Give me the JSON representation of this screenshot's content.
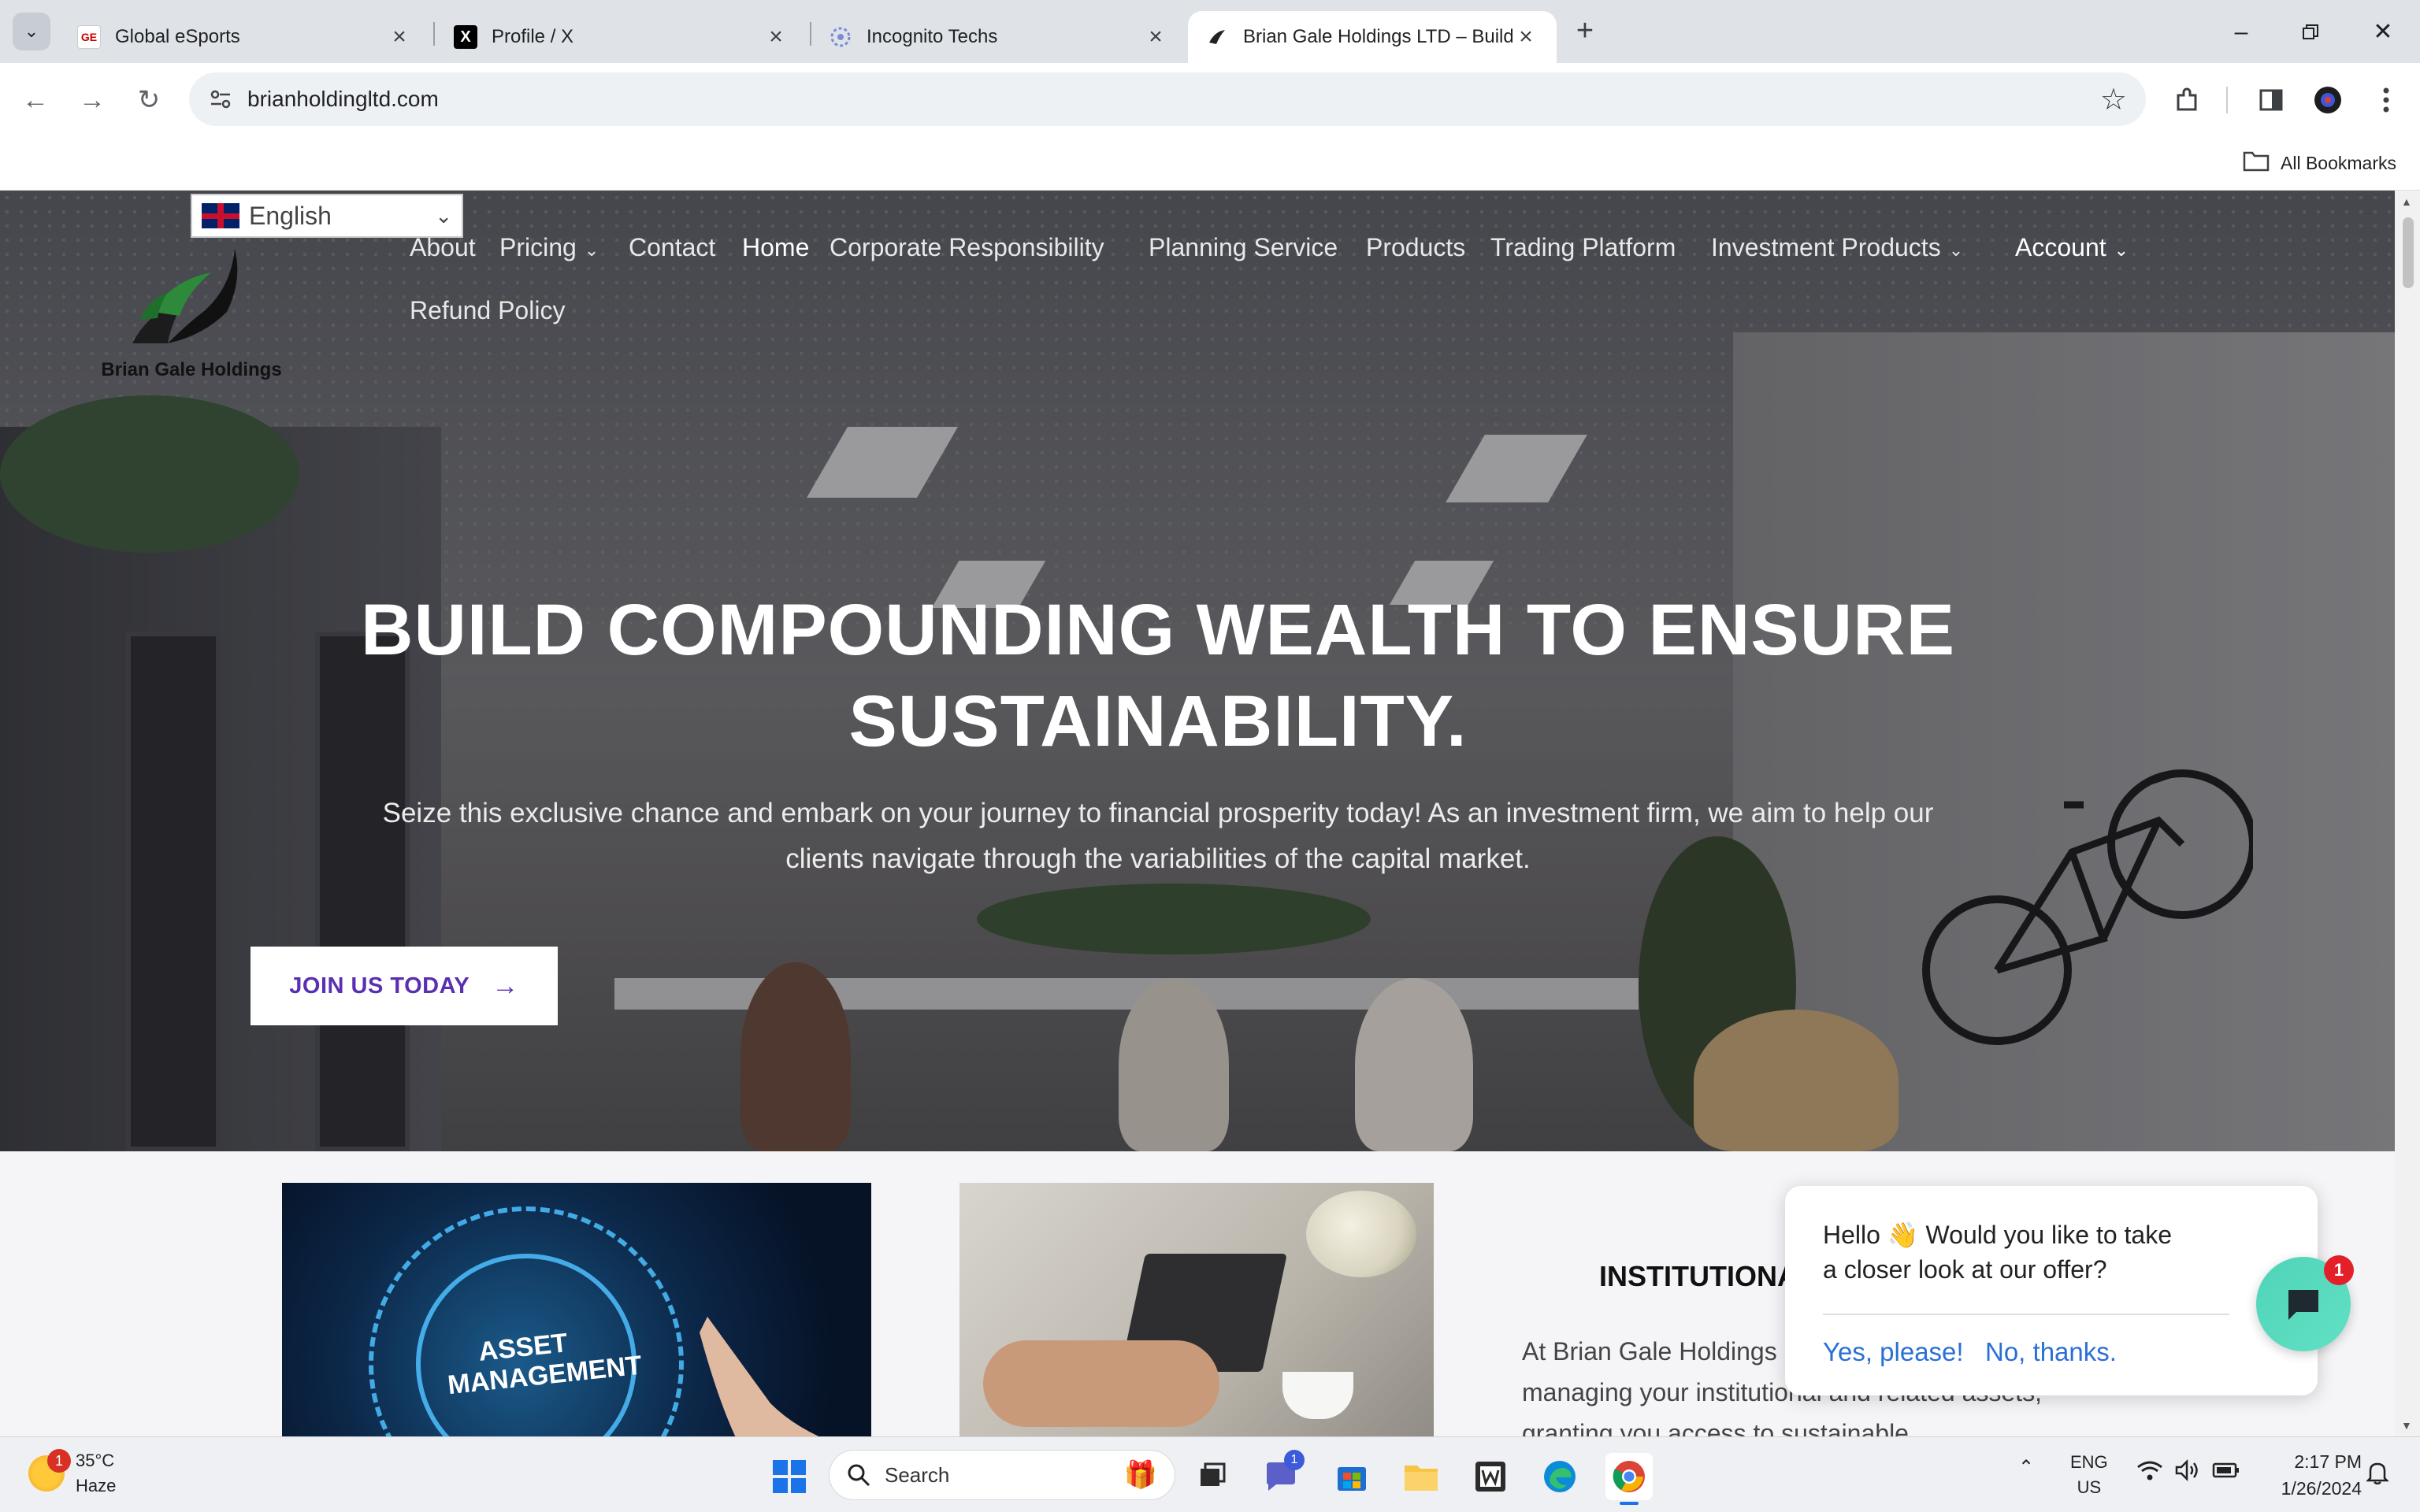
{
  "browser": {
    "tabs": [
      {
        "title": "Global eSports",
        "active": false
      },
      {
        "title": "Profile / X",
        "active": false
      },
      {
        "title": "Incognito Techs",
        "active": false
      },
      {
        "title": "Brian Gale Holdings LTD – Build",
        "active": true
      }
    ],
    "url": "brianholdingltd.com",
    "bookmarks_label": "All Bookmarks"
  },
  "page": {
    "translate": {
      "language": "English"
    },
    "logo_text": "Brian Gale Holdings",
    "menu": [
      {
        "label": "About"
      },
      {
        "label": "Pricing"
      },
      {
        "label": "Contact"
      },
      {
        "label": "Home"
      },
      {
        "label": "Corporate Responsibility"
      },
      {
        "label": "Planning Service"
      },
      {
        "label": "Products"
      },
      {
        "label": "Trading Platform"
      },
      {
        "label": "Investment Products"
      },
      {
        "label": "Account"
      },
      {
        "label": "Refund Policy"
      }
    ],
    "hero": {
      "title_line1": "BUILD COMPOUNDING WEALTH TO ENSURE",
      "title_line2": "SUSTAINABILITY.",
      "subtitle_line1": "Seize this exclusive chance and embark on your journey to financial prosperity today! As an investment firm, we aim to help our",
      "subtitle_line2": "clients navigate through the variabilities of the capital market.",
      "cta": "JOIN US TODAY"
    },
    "card1_image_text_line1": "ASSET",
    "card1_image_text_line2": "MANAGEMENT",
    "institutional": {
      "title": "INSTITUTIONAL",
      "text_line1": "At Brian Gale Holdings",
      "text_line2": "managing your institutional and related assets,",
      "text_line3": "granting you access to sustainable"
    },
    "chat": {
      "message_line1": "Hello 👋 Would you like to take",
      "message_line2": "a closer look at our offer?",
      "yes": "Yes, please!",
      "no": "No, thanks.",
      "badge": "1"
    }
  },
  "taskbar": {
    "weather_temp": "35°C",
    "weather_desc": "Haze",
    "weather_badge": "1",
    "search_label": "Search",
    "teams_badge": "1",
    "lang_line1": "ENG",
    "lang_line2": "US",
    "time": "2:17 PM",
    "date": "1/26/2024"
  },
  "colors": {
    "accent_purple": "#5a2fb2",
    "chat_teal": "#4fd4b7",
    "link_blue": "#2a6fd6"
  }
}
